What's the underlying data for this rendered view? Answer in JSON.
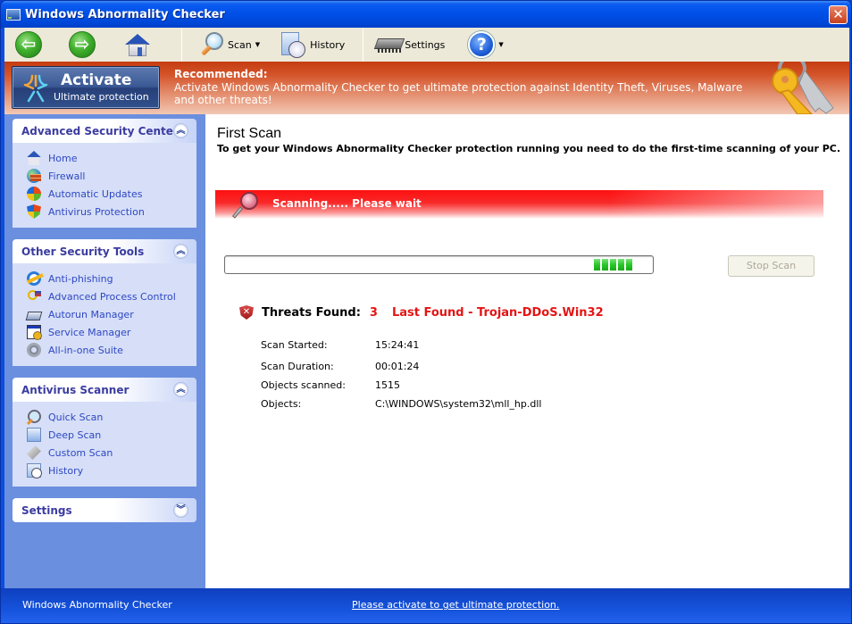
{
  "window": {
    "title": "Windows Abnormality Checker",
    "close_label": "✕"
  },
  "toolbar": {
    "back_glyph": "⇦",
    "forward_glyph": "⇨",
    "scan_label": "Scan",
    "history_label": "History",
    "settings_label": "Settings",
    "help_glyph": "?",
    "dropdown_glyph": "▼"
  },
  "banner": {
    "activate_title": "Activate",
    "activate_subtitle": "Ultimate protection",
    "recommended_title": "Recommended:",
    "recommended_text": "Activate Windows Abnormality Checker to get ultimate protection against Identity Theft, Viruses, Malware and other threats!"
  },
  "sidebar": {
    "panels": [
      {
        "title": "Advanced Security Center",
        "expanded": true,
        "toggle_glyph": "⌃",
        "items": [
          {
            "label": "Home",
            "icon": "home-icon"
          },
          {
            "label": "Firewall",
            "icon": "firewall-icon"
          },
          {
            "label": "Automatic Updates",
            "icon": "windows-update-icon"
          },
          {
            "label": "Antivirus Protection",
            "icon": "shield-icon"
          }
        ]
      },
      {
        "title": "Other Security Tools",
        "expanded": true,
        "toggle_glyph": "⌃",
        "items": [
          {
            "label": "Anti-phishing",
            "icon": "internet-explorer-icon"
          },
          {
            "label": "Advanced Process Control",
            "icon": "keys-flag-icon"
          },
          {
            "label": "Autorun Manager",
            "icon": "autorun-icon"
          },
          {
            "label": "Service Manager",
            "icon": "service-icon"
          },
          {
            "label": "All-in-one Suite",
            "icon": "gear-icon"
          }
        ]
      },
      {
        "title": "Antivirus Scanner",
        "expanded": true,
        "toggle_glyph": "⌃",
        "items": [
          {
            "label": "Quick Scan",
            "icon": "magnifier-icon"
          },
          {
            "label": "Deep Scan",
            "icon": "document-scan-icon"
          },
          {
            "label": "Custom Scan",
            "icon": "scanner-icon"
          },
          {
            "label": "History",
            "icon": "history-clock-icon"
          }
        ]
      },
      {
        "title": "Settings",
        "expanded": false,
        "toggle_glyph": "⌄",
        "items": []
      }
    ]
  },
  "main": {
    "title": "First Scan",
    "subtitle": "To get your Windows Abnormality Checker protection running you need to do the first-time scanning of your PC.",
    "scan_status": "Scanning..... Please wait",
    "progress_blocks": 5,
    "stop_button": "Stop Scan",
    "threats_label": "Threats Found:",
    "threats_count": "3",
    "last_found": "Last Found - Trojan-DDoS.Win32",
    "info": [
      {
        "key": "Scan Started:",
        "value": "15:24:41"
      },
      {
        "key": "Scan Duration:",
        "value": "00:01:24"
      },
      {
        "key": "Objects scanned:",
        "value": "1515"
      },
      {
        "key": "Objects:",
        "value": "C:\\WINDOWS\\system32\\mll_hp.dll"
      }
    ]
  },
  "statusbar": {
    "app_name": "Windows Abnormality Checker",
    "activate_link": "Please activate to get ultimate protection."
  },
  "colors": {
    "titlebar": "#0050e8",
    "banner": "#d4542a",
    "sidebar_bg": "#6b8fdf",
    "panel_body": "#d6dff7",
    "link": "#2f47c4",
    "alert_red": "#e41414",
    "progress_green": "#28c828"
  }
}
